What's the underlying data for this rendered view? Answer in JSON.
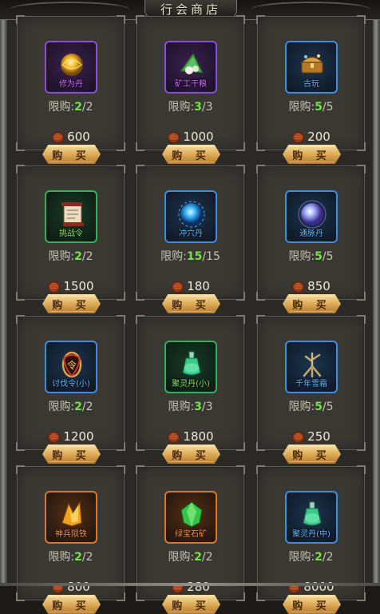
{
  "window": {
    "title": "行会商店"
  },
  "shop": {
    "limit_prefix": "限购:",
    "buy_label": "购 买",
    "items": [
      {
        "name": "修为丹",
        "rarity": "purple",
        "icon": "golden-orb-icon",
        "limit_current": "2",
        "limit_max": "/2",
        "price": "600"
      },
      {
        "name": "矿工干粮",
        "rarity": "purple",
        "icon": "rice-dumpling-icon",
        "limit_current": "3",
        "limit_max": "/3",
        "price": "1000"
      },
      {
        "name": "古玩",
        "rarity": "blue",
        "icon": "treasure-chest-icon",
        "limit_current": "5",
        "limit_max": "/5",
        "price": "200"
      },
      {
        "name": "挑战令",
        "rarity": "green",
        "icon": "scroll-icon",
        "limit_current": "2",
        "limit_max": "/2",
        "price": "1500"
      },
      {
        "name": "冲穴丹",
        "rarity": "blue",
        "icon": "blue-orb-icon",
        "limit_current": "15",
        "limit_max": "/15",
        "price": "180"
      },
      {
        "name": "通脉丹",
        "rarity": "blue",
        "icon": "violet-orb-icon",
        "limit_current": "5",
        "limit_max": "/5",
        "price": "850"
      },
      {
        "name": "讨伐令(小)",
        "rarity": "blue",
        "icon": "dragon-token-icon",
        "limit_current": "2",
        "limit_max": "/2",
        "price": "1200"
      },
      {
        "name": "聚灵丹(小)",
        "rarity": "green",
        "icon": "green-potion-icon",
        "limit_current": "3",
        "limit_max": "/3",
        "price": "1800"
      },
      {
        "name": "千年雪霜",
        "rarity": "blue",
        "icon": "ginseng-root-icon",
        "limit_current": "5",
        "limit_max": "/5",
        "price": "250"
      },
      {
        "name": "神兵陨铁",
        "rarity": "orange",
        "icon": "meteor-iron-icon",
        "limit_current": "2",
        "limit_max": "/2",
        "price": "800"
      },
      {
        "name": "绿宝石矿",
        "rarity": "orange",
        "icon": "emerald-ore-icon",
        "limit_current": "2",
        "limit_max": "/2",
        "price": "280"
      },
      {
        "name": "聚灵丹(中)",
        "rarity": "blue",
        "icon": "green-potion-icon",
        "limit_current": "2",
        "limit_max": "/2",
        "price": "8000"
      }
    ]
  },
  "colors": {
    "purple_frame": "#8d4cd6",
    "blue_frame": "#3c8fe0",
    "green_frame": "#34b05c",
    "orange_frame": "#e0742a",
    "limit_highlight": "#74e24a",
    "buy_button_gold": "#d9a652"
  }
}
